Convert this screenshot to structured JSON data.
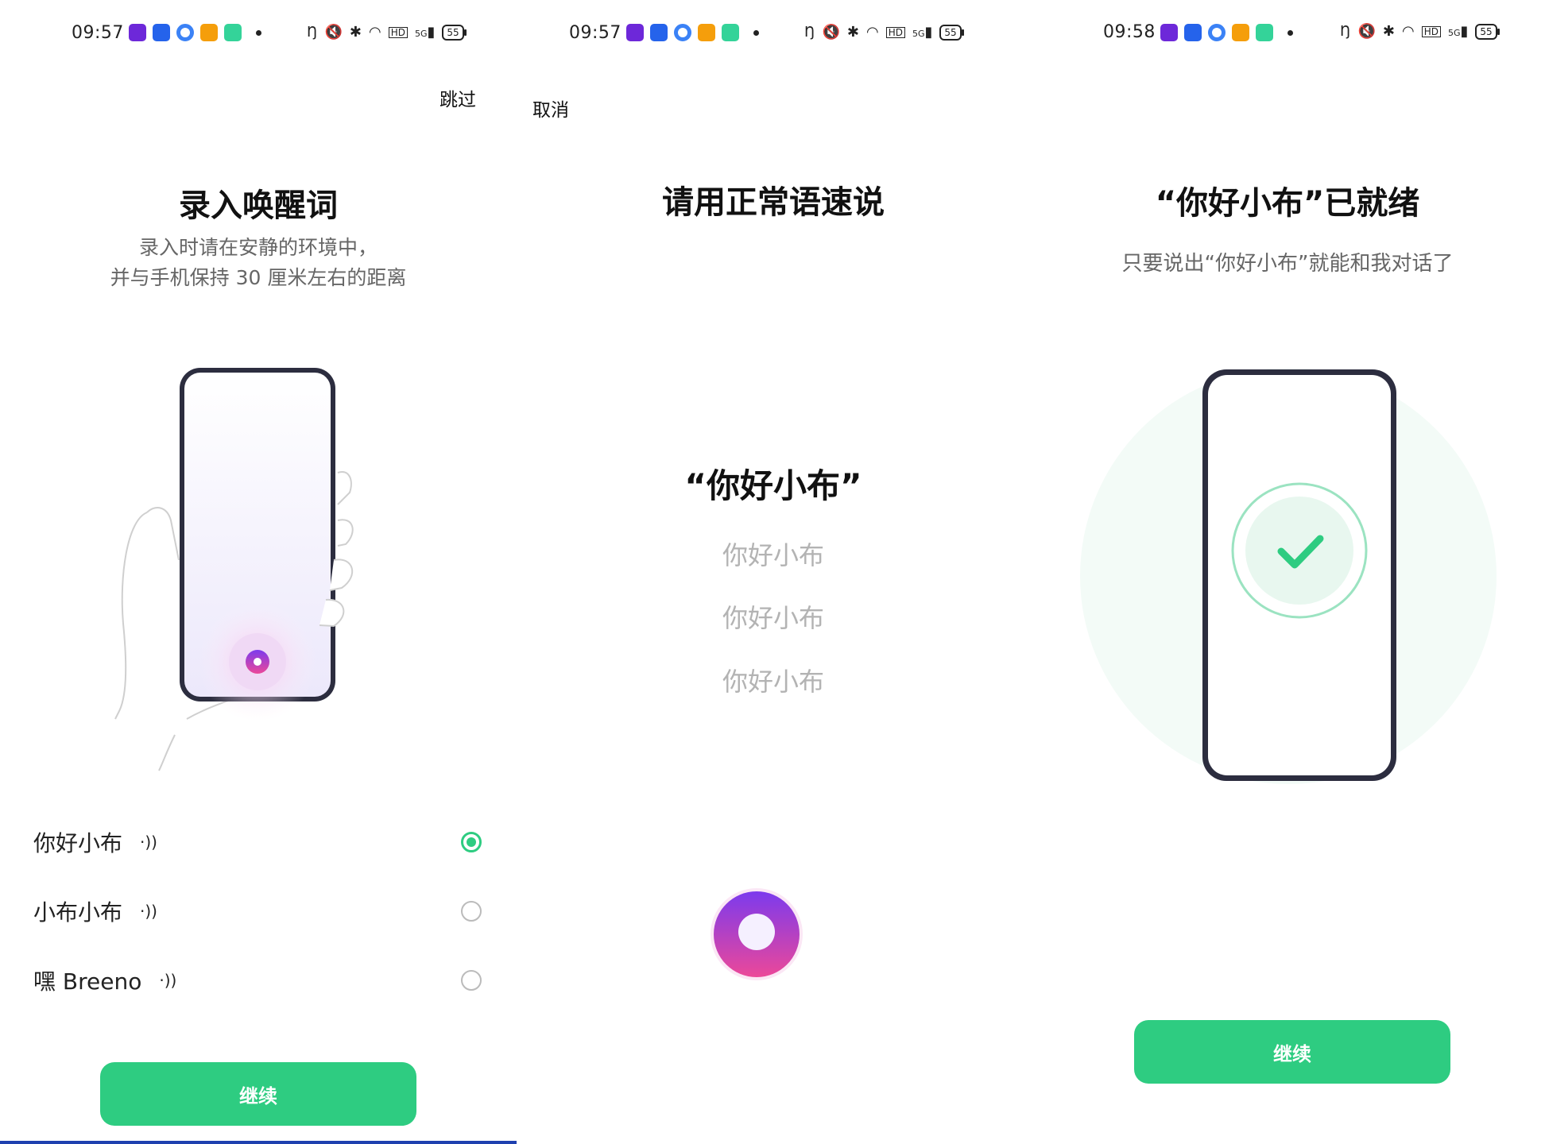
{
  "colors": {
    "accent": "#2ecc81",
    "mic_top": "#7c3aed",
    "mic_bottom": "#ec4899"
  },
  "panel1": {
    "status": {
      "time": "09:57",
      "battery": "55",
      "net": "5G"
    },
    "skip_label": "跳过",
    "title": "录入唤醒词",
    "subtitle_line1": "录入时请在安静的环境中，",
    "subtitle_line2": "并与手机保持 30 厘米左右的距离",
    "options": [
      {
        "label": "你好小布",
        "icon": "sound-icon",
        "selected": true
      },
      {
        "label": "小布小布",
        "icon": "sound-icon",
        "selected": false
      },
      {
        "label": "嘿 Breeno",
        "icon": "sound-icon",
        "selected": false
      }
    ],
    "continue_label": "继续"
  },
  "panel2": {
    "status": {
      "time": "09:57",
      "battery": "55",
      "net": "5G"
    },
    "cancel_label": "取消",
    "title": "请用正常语速说",
    "main_phrase": "“你好小布”",
    "phrases": [
      "你好小布",
      "你好小布",
      "你好小布"
    ]
  },
  "panel3": {
    "status": {
      "time": "09:58",
      "battery": "55",
      "net": "5G"
    },
    "title": "“你好小布”已就绪",
    "subtitle": "只要说出“你好小布”就能和我对话了",
    "continue_label": "继续"
  }
}
